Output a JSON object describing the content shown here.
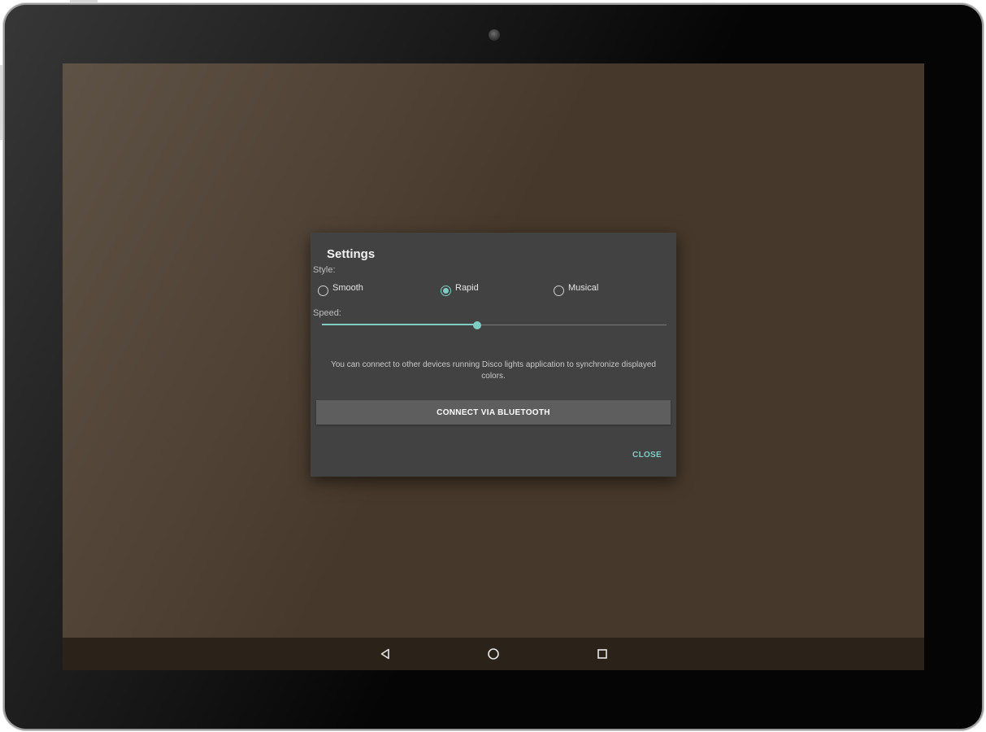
{
  "dialog": {
    "title": "Settings",
    "style_label": "Style:",
    "style_options": [
      {
        "label": "Smooth",
        "selected": false
      },
      {
        "label": "Rapid",
        "selected": true
      },
      {
        "label": "Musical",
        "selected": false
      }
    ],
    "speed_label": "Speed:",
    "speed_value": 0.45,
    "info_text": "You can connect to other devices running Disco lights application to synchronize displayed colors.",
    "connect_button_label": "CONNECT VIA BLUETOOTH",
    "close_button_label": "CLOSE"
  },
  "navigation": {
    "icons": [
      "back-triangle-icon",
      "home-circle-icon",
      "recents-square-icon"
    ]
  },
  "colors": {
    "accent": "#80cbc4",
    "dialog_background": "#424242",
    "screen_background": "#46382a",
    "navbar_background": "#2b2219"
  }
}
